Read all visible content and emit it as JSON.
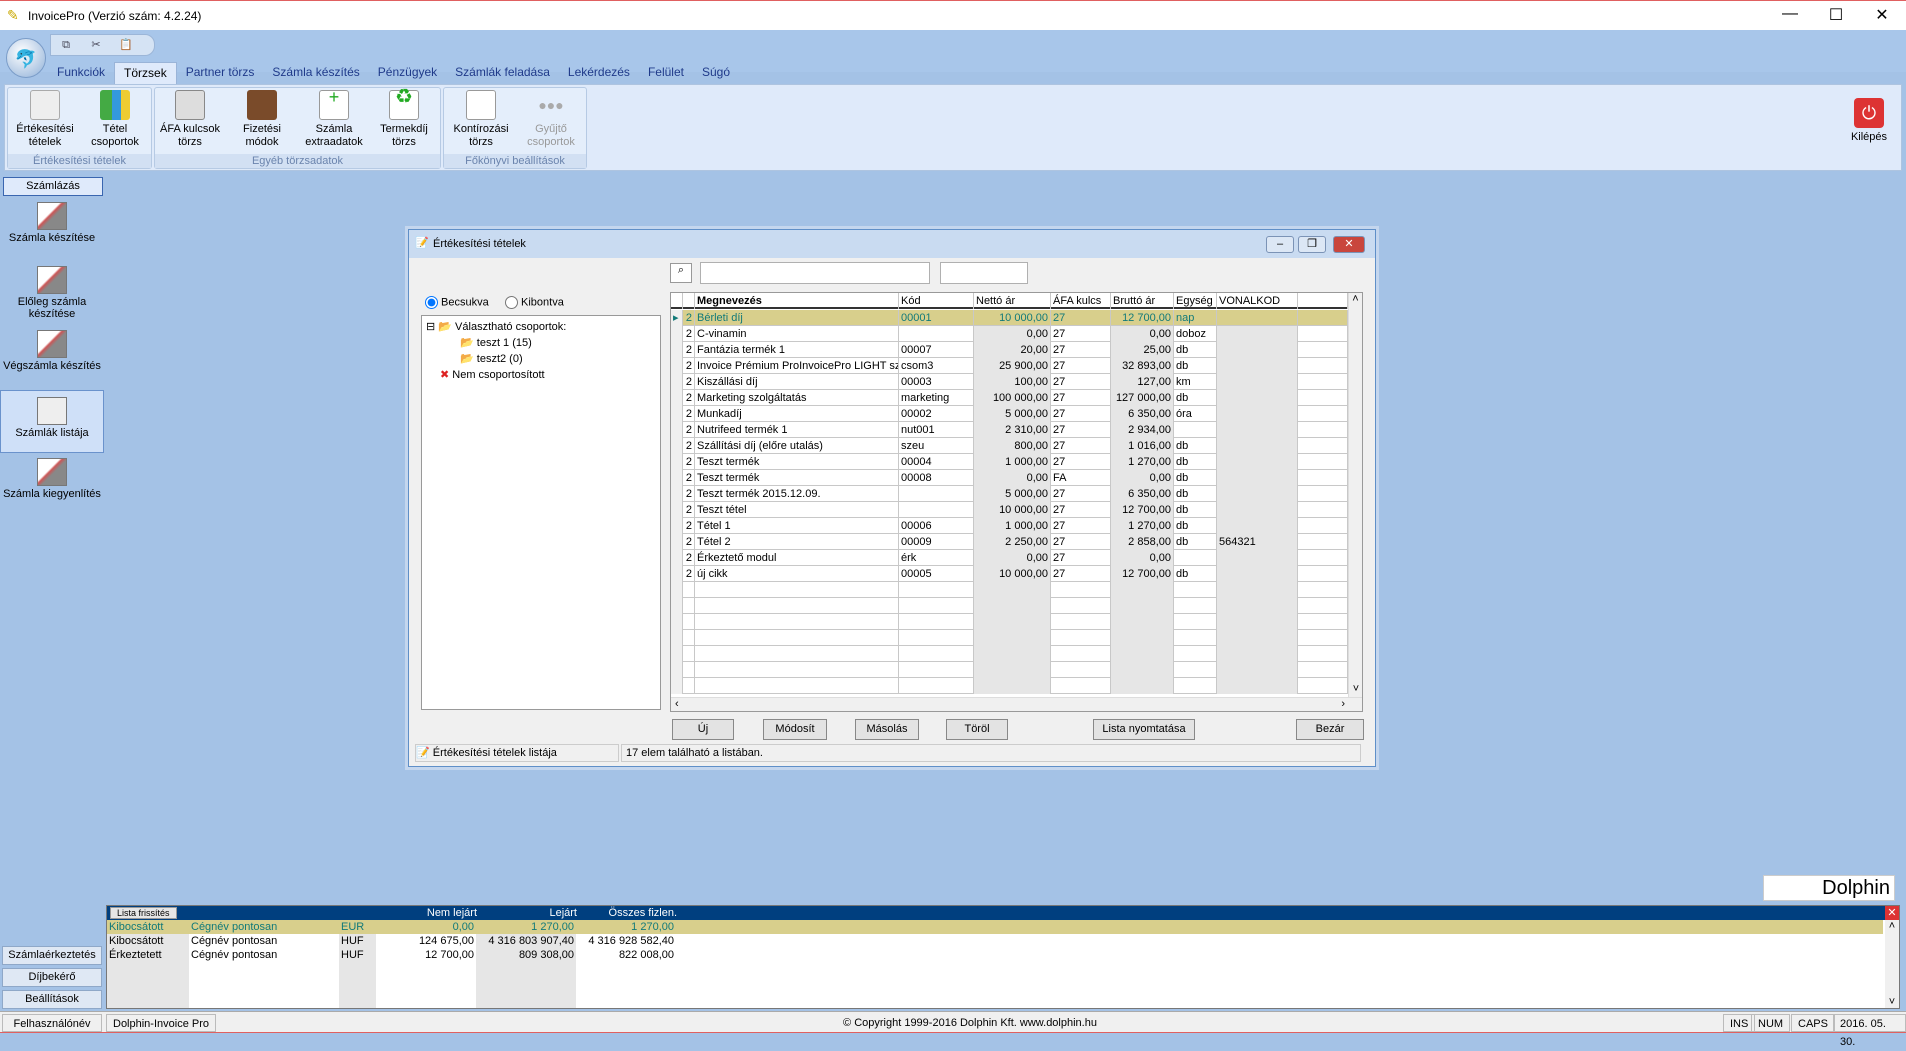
{
  "app": {
    "title": "InvoicePro  (Verzió szám: 4.2.24)"
  },
  "quick_access": [
    "copy-icon",
    "cut-icon",
    "paste-icon"
  ],
  "tabs": [
    "Funkciók",
    "Törzsek",
    "Partner törzs",
    "Számla készítés",
    "Pénzügyek",
    "Számlák feladása",
    "Lekérdezés",
    "Felület",
    "Súgó"
  ],
  "active_tab": "Törzsek",
  "ribbon": {
    "groups": [
      {
        "label": "Értékesítési tételek",
        "buttons": [
          {
            "l1": "Értékesítési",
            "l2": "tételek"
          },
          {
            "l1": "Tétel",
            "l2": "csoportok"
          }
        ]
      },
      {
        "label": "Egyéb törzsadatok",
        "buttons": [
          {
            "l1": "ÁFA kulcsok",
            "l2": "törzs"
          },
          {
            "l1": "Fizetési",
            "l2": "módok"
          },
          {
            "l1": "Számla",
            "l2": "extraadatok"
          },
          {
            "l1": "Termekdíj",
            "l2": "törzs"
          }
        ]
      },
      {
        "label": "Főkönyvi beállítások",
        "buttons": [
          {
            "l1": "Kontírozási",
            "l2": "törzs"
          },
          {
            "l1": "Gyűjtő",
            "l2": "csoportok"
          }
        ]
      }
    ],
    "exit": "Kilépés"
  },
  "sidebar": {
    "header": "Számlázás",
    "items": [
      "Számla készítése",
      "Előleg számla készítése",
      "Végszámla készítés",
      "Számlák listája",
      "Számla kiegyenlítés"
    ],
    "active": "Számlák listája",
    "bottom": [
      "Számlaérkeztetés",
      "Díjbekérő",
      "Beállítások"
    ]
  },
  "dialog": {
    "title": "Értékesítési tételek",
    "search_value": "",
    "search_value2": "",
    "radios": [
      {
        "label": "Becsukva",
        "checked": true
      },
      {
        "label": "Kibontva",
        "checked": false
      }
    ],
    "tree": {
      "root": "Választható csoportok:",
      "children": [
        "teszt 1 (15)",
        "teszt2 (0)"
      ],
      "ungrouped": "Nem csoportosított"
    },
    "columns": [
      "",
      "",
      "Megnevezés",
      "Kód",
      "Nettó ár",
      "ÁFA kulcs",
      "Bruttó ár",
      "Egység",
      "VONALKOD"
    ],
    "rows": [
      [
        "2",
        "Bérleti díj",
        "00001",
        "10 000,00",
        "27",
        "12 700,00",
        "nap",
        ""
      ],
      [
        "2",
        "C-vinamin",
        "",
        "0,00",
        "27",
        "0,00",
        "doboz",
        ""
      ],
      [
        "2",
        "Fantázia termék 1",
        "00007",
        "20,00",
        "27",
        "25,00",
        "db",
        ""
      ],
      [
        "2",
        "Invoice Prémium ProInvoicePro LIGHT szár",
        "csom3",
        "25 900,00",
        "27",
        "32 893,00",
        "db",
        ""
      ],
      [
        "2",
        "Kiszállási díj",
        "00003",
        "100,00",
        "27",
        "127,00",
        "km",
        ""
      ],
      [
        "2",
        "Marketing szolgáltatás",
        "marketing",
        "100 000,00",
        "27",
        "127 000,00",
        "db",
        ""
      ],
      [
        "2",
        "Munkadíj",
        "00002",
        "5 000,00",
        "27",
        "6 350,00",
        "óra",
        ""
      ],
      [
        "2",
        "Nutrifeed termék 1",
        "nut001",
        "2 310,00",
        "27",
        "2 934,00",
        "",
        ""
      ],
      [
        "2",
        "Szállítási díj  (előre utalás)",
        "szeu",
        "800,00",
        "27",
        "1 016,00",
        "db",
        ""
      ],
      [
        "2",
        "Teszt termék",
        "00004",
        "1 000,00",
        "27",
        "1 270,00",
        "db",
        ""
      ],
      [
        "2",
        "Teszt termék",
        "00008",
        "0,00",
        "FA",
        "0,00",
        "db",
        ""
      ],
      [
        "2",
        "Teszt termék 2015.12.09.",
        "",
        "5 000,00",
        "27",
        "6 350,00",
        "db",
        ""
      ],
      [
        "2",
        "Teszt tétel",
        "",
        "10 000,00",
        "27",
        "12 700,00",
        "db",
        ""
      ],
      [
        "2",
        "Tétel 1",
        "00006",
        "1 000,00",
        "27",
        "1 270,00",
        "db",
        ""
      ],
      [
        "2",
        "Tétel 2",
        "00009",
        "2 250,00",
        "27",
        "2 858,00",
        "db",
        "564321"
      ],
      [
        "2",
        "Érkeztető modul",
        "érk",
        "0,00",
        "27",
        "0,00",
        "",
        ""
      ],
      [
        "2",
        "új cikk",
        "00005",
        "10 000,00",
        "27",
        "12 700,00",
        "db",
        ""
      ]
    ],
    "selected_row": 0,
    "buttons": [
      "Új",
      "Módosít",
      "Másolás",
      "Töröl",
      "Lista nyomtatása",
      "Bezár"
    ],
    "status_left": "Értékesítési tételek listája",
    "status_right": "17 elem található a listában."
  },
  "logo": "Dolphin",
  "bottom_panel": {
    "refresh": "Lista frissítés",
    "headers": [
      "Nem lejárt",
      "Lejárt",
      "Összes fizlen."
    ],
    "rows": [
      [
        "Kibocsátott",
        "Cégnév pontosan",
        "EUR",
        "0,00",
        "1 270,00",
        "1 270,00"
      ],
      [
        "Kibocsátott",
        "Cégnév pontosan",
        "HUF",
        "124 675,00",
        "4 316 803 907,40",
        "4 316 928 582,40"
      ],
      [
        "Érkeztetett",
        "Cégnév pontosan",
        "HUF",
        "12 700,00",
        "809 308,00",
        "822 008,00"
      ]
    ]
  },
  "statusbar": {
    "user": "Felhasználónév",
    "app": "Dolphin-Invoice Pro",
    "copyright": "© Copyright 1999-2016 Dolphin Kft. www.dolphin.hu",
    "ins": "INS",
    "num": "NUM",
    "caps": "CAPS",
    "date": "2016. 05. 30."
  },
  "colors": {
    "selected_row_bg": "#d8cf8c",
    "selected_row_text": "#127a79",
    "bottom_header": "#003f7f"
  }
}
